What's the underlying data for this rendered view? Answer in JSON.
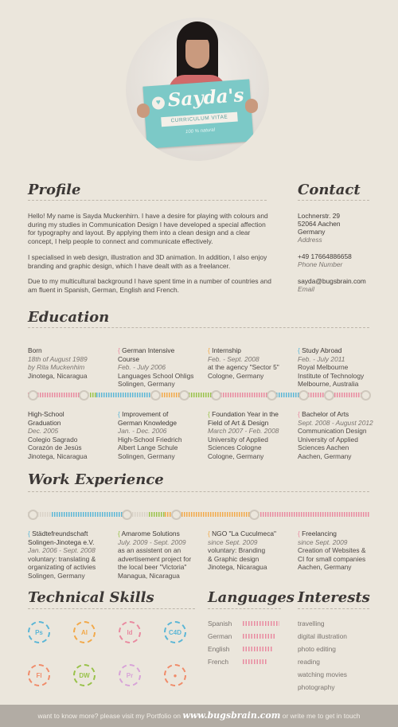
{
  "photo": {
    "sign_name": "Sayda's",
    "sign_subtitle": "CURRICULUM VITAE",
    "sign_note": "100 % natural"
  },
  "profile": {
    "title": "Profile",
    "paragraphs": [
      "Hello! My name is Sayda Muckenhirn. I have a desire for playing with colours and during my studies in Communication Design I have developed a special affection for typography and layout. By applying them into a clean design and a clear concept, I help people to connect and communicate effectively.",
      "I specialised in web design, illustration and 3D animation. In addition, I also enjoy branding and graphic design, which I have dealt with as a freelancer.",
      "Due to my multicultural background I have spent time in a number of countries and am fluent in Spanish, German, English and French."
    ]
  },
  "contact": {
    "title": "Contact",
    "street": "Lochnerstr. 29",
    "city": "52064 Aachen",
    "country": "Germany",
    "address_label": "Address",
    "phone": "+49 17664886658",
    "phone_label": "Phone Number",
    "email": "sayda@bugsbrain.com",
    "email_label": "Email"
  },
  "education": {
    "title": "Education",
    "top": [
      {
        "title": "Born",
        "date": "18th of August 1989",
        "line2": "by Rita Muckenhim",
        "lines": [
          "Jinotega, Nicaragua"
        ],
        "bracket": ""
      },
      {
        "title": "German Intensive",
        "title2": "Course",
        "date": "Feb. - July 2006",
        "lines": [
          "Languages School Ohligs",
          "Solingen, Germany"
        ],
        "bracket": "pink"
      },
      {
        "title": "Internship",
        "date": "Feb. - Sept. 2008",
        "lines": [
          "at the agency \"Sector 5\"",
          "Cologne, Germany"
        ],
        "bracket": "orange"
      },
      {
        "title": "Study Abroad",
        "date": "Feb. - July 2011",
        "lines": [
          "Royal Melbourne",
          "Institute of Technology",
          "Melbourne, Australia"
        ],
        "bracket": "blue"
      }
    ],
    "bottom": [
      {
        "title": "High-School",
        "title2": "Graduation",
        "date": "Dec. 2005",
        "lines": [
          "Colegio Sagrado",
          "Corazón de Jesús",
          "Jinotega, Nicaragua"
        ],
        "bracket": ""
      },
      {
        "title": "Improvement of",
        "title2": "German Knowledge",
        "date": "Jan. - Dec. 2006",
        "lines": [
          "High-School Friedrich",
          "Albert Lange Schule",
          "Solingen, Germany"
        ],
        "bracket": "blue"
      },
      {
        "title": "Foundation Year in the",
        "title2": "Field of Art & Design",
        "date": "March 2007 - Feb. 2008",
        "lines": [
          "University of Applied",
          "Sciences Cologne",
          "Cologne, Germany"
        ],
        "bracket": "green"
      },
      {
        "title": "Bachelor of Arts",
        "date": "Sept. 2008 - August 2012",
        "lines": [
          "Communication Design",
          "University of Applied",
          "Sciences Aachen",
          "Aachen, Germany"
        ],
        "bracket": "pink"
      }
    ]
  },
  "work": {
    "title": "Work Experience",
    "items": [
      {
        "title": "Städtefreundschaft",
        "title2": "Solingen-Jinotega e.V.",
        "date": "Jan. 2006 - Sept. 2008",
        "lines": [
          "voluntary: translating &",
          "organizating of activies",
          "Solingen, Germany"
        ],
        "bracket": "blue"
      },
      {
        "title": "Amarome Solutions",
        "date": "July. 2009 - Sept. 2009",
        "lines": [
          "as an assistent on an",
          "advertisement project for",
          "the local beer \"Victoria\"",
          "Managua, Nicaragua"
        ],
        "bracket": "green"
      },
      {
        "title": "NGO \"La Cuculmeca\"",
        "date": "since Sept. 2009",
        "lines": [
          "voluntary: Branding",
          "& Graphic design",
          "Jinotega, Nicaragua"
        ],
        "bracket": "orange"
      },
      {
        "title": "Freelancing",
        "date": "since Sept. 2009",
        "lines": [
          "Creation of Websites &",
          "CI for small companies",
          "Aachen, Germany"
        ],
        "bracket": "pink"
      }
    ]
  },
  "skills": {
    "title": "Technical Skills",
    "items": [
      {
        "label": "Ps",
        "color": "#5bb6d6"
      },
      {
        "label": "AI",
        "color": "#f2a94a"
      },
      {
        "label": "Id",
        "color": "#e98aa0"
      },
      {
        "label": "C4D",
        "color": "#5bb6d6"
      },
      {
        "label": "Fl",
        "color": "#f08c6a"
      },
      {
        "label": "DW",
        "color": "#99c24a"
      },
      {
        "label": "Pr",
        "color": "#d8a3d8"
      },
      {
        "label": "",
        "color": "#f08c6a"
      }
    ]
  },
  "languages": {
    "title": "Languages",
    "items": [
      {
        "name": "Spanish",
        "level": 1.0
      },
      {
        "name": "German",
        "level": 0.9
      },
      {
        "name": "English",
        "level": 0.8
      },
      {
        "name": "French",
        "level": 0.6
      }
    ]
  },
  "interests": {
    "title": "Interests",
    "items": [
      "travelling",
      "digital illustration",
      "photo editing",
      "reading",
      "watching movies",
      "photography"
    ]
  },
  "footer": {
    "before": "want to know more? please visit my Portfolio on",
    "url": "www.bugsbrain.com",
    "after": "or write me to get in touch"
  },
  "colors": {
    "pink": "#e98aa0",
    "blue": "#5bb6d6",
    "green": "#99c24a",
    "orange": "#f2a94a",
    "background": "#ebe6dc"
  }
}
